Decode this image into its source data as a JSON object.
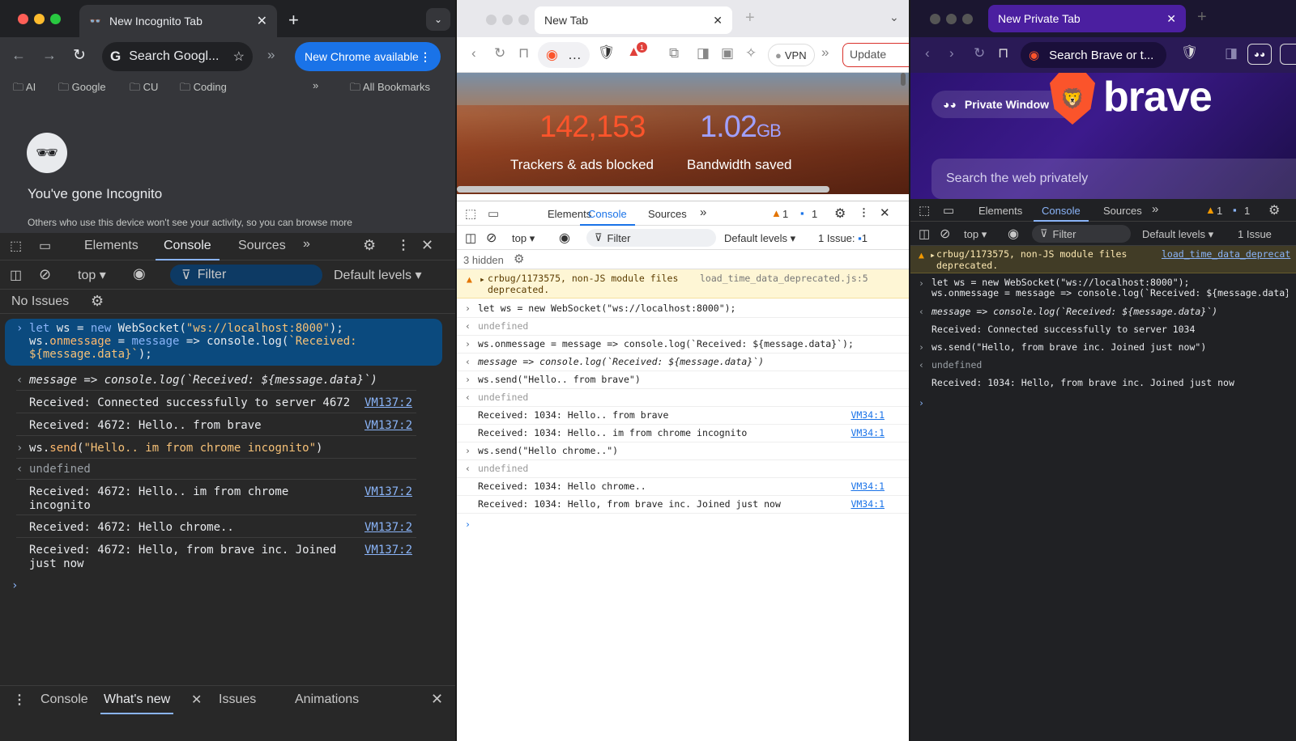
{
  "w1": {
    "tab_title": "New Incognito Tab",
    "omnibox": "Search Googl...",
    "update_btn": "New Chrome available",
    "bookmarks": [
      "AI",
      "Google",
      "CU",
      "Coding"
    ],
    "all_bookmarks": "All Bookmarks",
    "incog_title": "You've gone Incognito",
    "incog_text": "Others who use this device won't see your activity, so you can browse more",
    "devtools": {
      "tabs": [
        "Elements",
        "Console",
        "Sources"
      ],
      "context": "top",
      "filter": "Filter",
      "levels": "Default levels",
      "no_issues": "No Issues",
      "input1_line1": "let ws = new WebSocket(\"ws://localhost:8000\");",
      "input1_line2": "ws.onmessage = message => console.log(`Received:",
      "input1_line3": "${message.data}`);",
      "ret1": "message => console.log(`Received: ${message.data}`)",
      "logs": [
        {
          "text": "Received: Connected successfully to server 4672",
          "src": "VM137:2"
        },
        {
          "text": "Received: 4672: Hello.. from brave",
          "src": "VM137:2"
        }
      ],
      "input2": "ws.send(\"Hello.. im from chrome incognito\")",
      "ret2": "undefined",
      "logs2": [
        {
          "text": "Received: 4672: Hello.. im from chrome\nincognito",
          "src": "VM137:2"
        },
        {
          "text": "Received: 4672: Hello chrome..",
          "src": "VM137:2"
        },
        {
          "text": "Received: 4672: Hello, from brave inc. Joined\njust now",
          "src": "VM137:2"
        }
      ]
    },
    "drawer_tabs": [
      "Console",
      "What's new",
      "Issues",
      "Animations"
    ]
  },
  "w2": {
    "tab_title": "New Tab",
    "vpn": "VPN",
    "update": "Update",
    "trackers_num": "142,153",
    "trackers_label": "Trackers & ads blocked",
    "bw_num": "1.02",
    "bw_unit": "GB",
    "bw_label": "Bandwidth saved",
    "devtools": {
      "tabs": [
        "Elements",
        "Console",
        "Sources"
      ],
      "warn_count": "1",
      "msg_count": "1",
      "context": "top",
      "filter": "Filter",
      "levels": "Default levels",
      "issue_label": "1 Issue:",
      "issue_count": "1",
      "hidden": "3 hidden",
      "warn_text": "crbug/1173575, non-JS module files\ndeprecated.",
      "warn_src": "load_time_data_deprecated.js:5",
      "lines": [
        {
          "kind": "in",
          "text": "let ws = new WebSocket(\"ws://localhost:8000\");"
        },
        {
          "kind": "ret",
          "text": "undefined"
        },
        {
          "kind": "in",
          "text": "ws.onmessage = message => console.log(`Received: ${message.data}`);"
        },
        {
          "kind": "ret",
          "text": "message => console.log(`Received: ${message.data}`)"
        },
        {
          "kind": "in",
          "text": "ws.send(\"Hello.. from brave\")"
        },
        {
          "kind": "ret",
          "text": "undefined"
        },
        {
          "kind": "log",
          "text": "Received: 1034: Hello.. from brave",
          "src": "VM34:1"
        },
        {
          "kind": "log",
          "text": "Received: 1034: Hello.. im from chrome incognito",
          "src": "VM34:1"
        },
        {
          "kind": "in",
          "text": "ws.send(\"Hello chrome..\")"
        },
        {
          "kind": "ret",
          "text": "undefined"
        },
        {
          "kind": "log",
          "text": "Received: 1034: Hello chrome..",
          "src": "VM34:1"
        },
        {
          "kind": "log",
          "text": "Received: 1034: Hello, from brave inc. Joined just now",
          "src": "VM34:1"
        }
      ]
    }
  },
  "w3": {
    "tab_title": "New Private Tab",
    "omnibox": "Search Brave or t...",
    "private_window": "Private Window",
    "brand": "brave",
    "search_placeholder": "Search the web privately",
    "devtools": {
      "tabs": [
        "Elements",
        "Console",
        "Sources"
      ],
      "warn_count": "1",
      "msg_count": "1",
      "context": "top",
      "filter": "Filter",
      "levels": "Default levels",
      "issue_label": "1 Issue",
      "warn_text": "crbug/1173575, non-JS module files\ndeprecated.",
      "warn_src": "load_time_data_deprecat",
      "lines": [
        {
          "kind": "in",
          "text": "let ws = new WebSocket(\"ws://localhost:8000\");\nws.onmessage = message => console.log(`Received: ${message.data}"
        },
        {
          "kind": "ret",
          "text": "message => console.log(`Received: ${message.data}`)"
        },
        {
          "kind": "log",
          "text": "Received: Connected successfully to server 1034"
        },
        {
          "kind": "in",
          "text": "ws.send(\"Hello, from brave inc. Joined just now\")"
        },
        {
          "kind": "ret",
          "text": "undefined"
        },
        {
          "kind": "log",
          "text": "Received: 1034: Hello, from brave inc. Joined just now"
        }
      ]
    }
  },
  "colors": {
    "chrome_dark": "#202124",
    "devtools_dark": "#282828",
    "accent_blue": "#8ab4f8",
    "brave_purple": "#3b1a6e",
    "brave_orange": "#fb542b",
    "warn_yellow": "#fef6d5"
  }
}
